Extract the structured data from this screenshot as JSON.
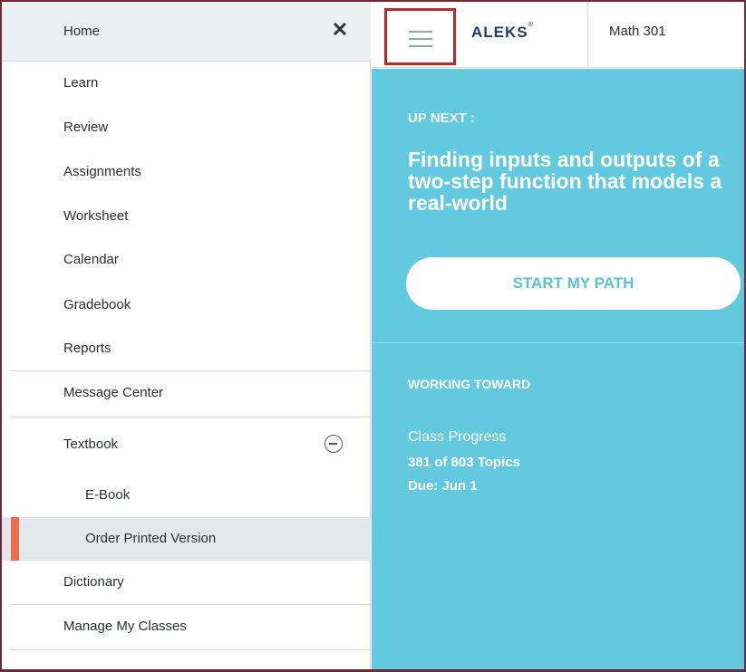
{
  "sidebar": {
    "home_label": "Home",
    "close_glyph": "✕",
    "items": [
      {
        "label": "Learn"
      },
      {
        "label": "Review"
      },
      {
        "label": "Assignments"
      },
      {
        "label": "Worksheet"
      },
      {
        "label": "Calendar"
      },
      {
        "label": "Gradebook"
      },
      {
        "label": "Reports"
      },
      {
        "label": "Message Center"
      },
      {
        "label": "Textbook"
      },
      {
        "label": "E-Book"
      },
      {
        "label": "Order Printed Version"
      },
      {
        "label": "Dictionary"
      },
      {
        "label": "Manage My Classes"
      }
    ],
    "selected_item": "Order Printed Version",
    "selected_color": "#ec6c4b"
  },
  "topbar": {
    "logo": "ALEKS",
    "logo_mark": "®",
    "class_name": "Math 301"
  },
  "main": {
    "up_next_label": "UP NEXT :",
    "topic_title": "Finding inputs and outputs of a two-step function that models a real-world",
    "start_button": "START MY PATH",
    "working_toward": "WORKING TOWARD",
    "progress_label": "Class Progress",
    "progress_count": "381 of 803 Topics",
    "due": "Due: Jun 1",
    "background_color": "#63c9de"
  }
}
